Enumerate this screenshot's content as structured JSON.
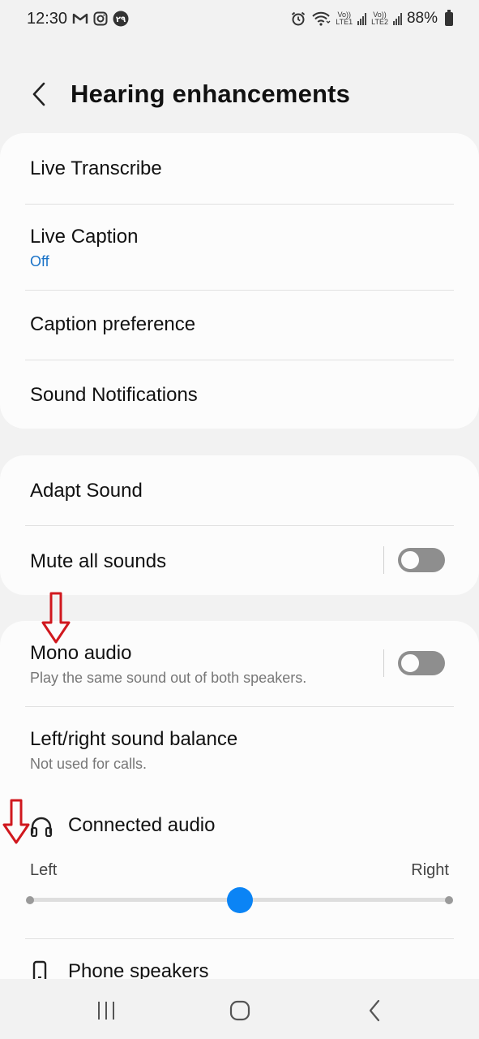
{
  "status_bar": {
    "time": "12:30",
    "left_icons": [
      "gmail-icon",
      "instagram-icon",
      "app-badge-icon"
    ],
    "app_badge_text": "۲۹",
    "sim1_label_top": "Vo))",
    "sim1_label_bottom": "LTE1",
    "sim2_label_top": "Vo))",
    "sim2_label_bottom": "LTE2",
    "battery_text": "88%"
  },
  "header": {
    "title": "Hearing enhancements",
    "back_icon": "chevron-left-icon"
  },
  "card1": {
    "items": [
      {
        "label": "Live Transcribe"
      },
      {
        "label": "Live Caption",
        "sub": "Off"
      },
      {
        "label": "Caption preference"
      },
      {
        "label": "Sound Notifications"
      }
    ]
  },
  "card2": {
    "items": [
      {
        "label": "Adapt Sound"
      },
      {
        "label": "Mute all sounds",
        "toggle_on": false
      }
    ]
  },
  "card3": {
    "mono_audio": {
      "label": "Mono audio",
      "sub": "Play the same sound out of both speakers.",
      "toggle_on": false
    },
    "balance": {
      "label": "Left/right sound balance",
      "sub": "Not used for calls."
    },
    "connected_audio": {
      "label": "Connected audio",
      "icon": "headphones-icon",
      "left_label": "Left",
      "right_label": "Right",
      "balance_value": 0.5
    },
    "phone_speakers": {
      "label": "Phone speakers",
      "icon": "phone-icon"
    }
  },
  "colors": {
    "accent": "#0b84f5",
    "link_blue": "#1a73c8",
    "annotation_red": "#d0181e",
    "background": "#f2f2f2",
    "card": "#fcfcfc"
  },
  "nav_bar": {
    "buttons": [
      "recent-apps-icon",
      "home-icon",
      "back-icon"
    ]
  }
}
